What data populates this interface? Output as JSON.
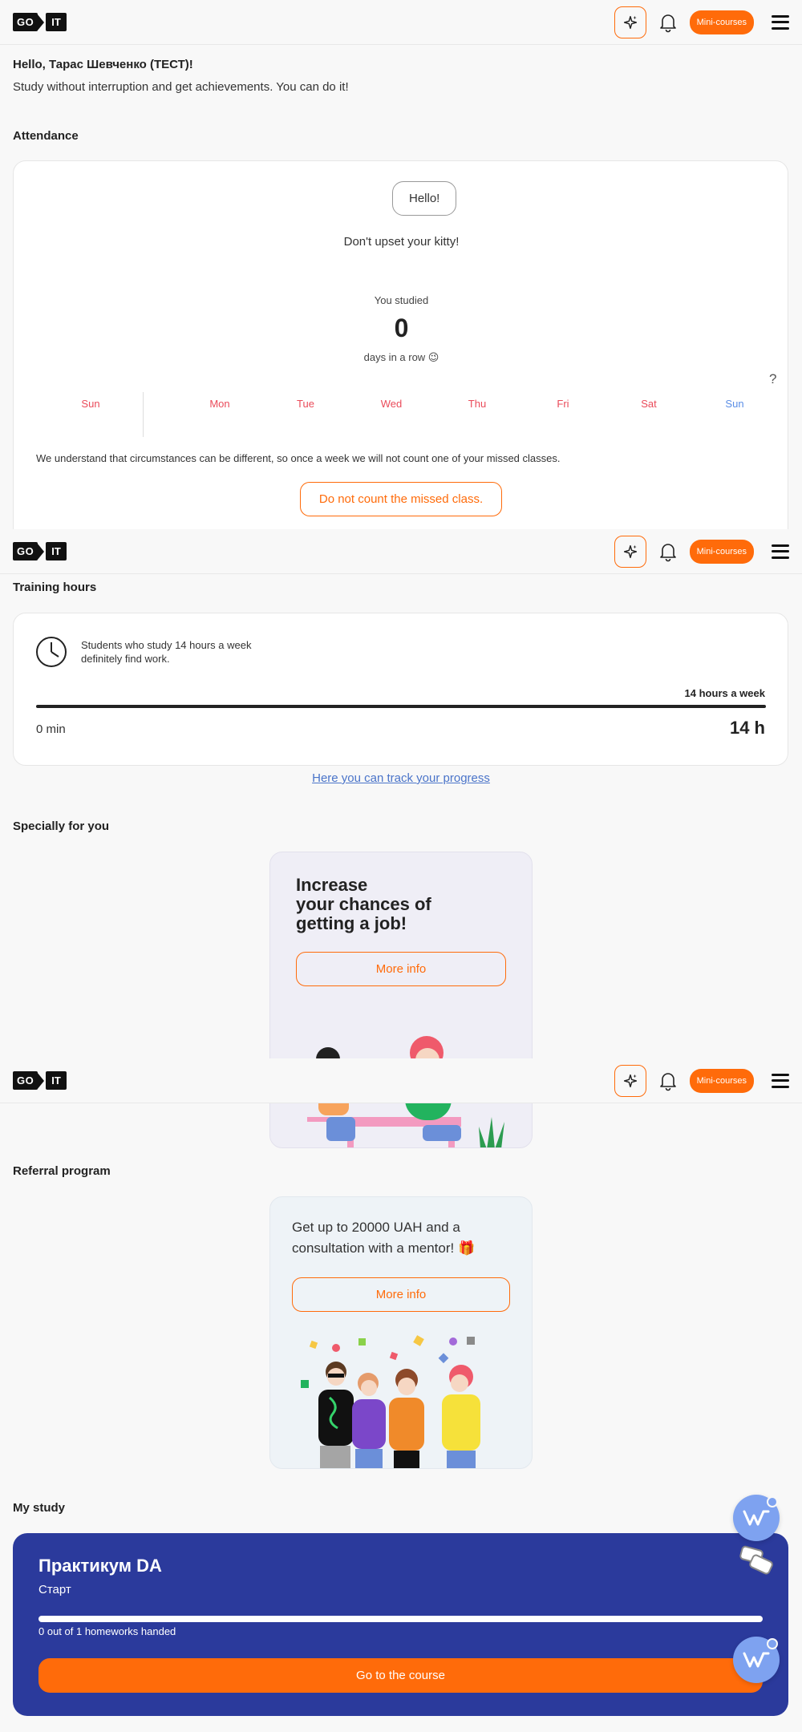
{
  "header": {
    "logo_go": "GO",
    "logo_it": "IT",
    "mini_courses": "Mini-courses"
  },
  "greeting": {
    "title": "Hello, Тарас Шевченко (ТЕСТ)!",
    "subtitle": "Study without interruption and get achievements. You can do it!"
  },
  "attendance": {
    "title": "Attendance",
    "bubble": "Hello!",
    "kitty": "Don't upset your kitty!",
    "you_studied": "You studied",
    "count": "0",
    "days_row": "days in a row 😉",
    "help": "?",
    "days": [
      "Sun",
      "Mon",
      "Tue",
      "Wed",
      "Thu",
      "Fri",
      "Sat",
      "Sun"
    ],
    "note": "We understand that circumstances can be different, so once a week we will not count one of your missed classes.",
    "button": "Do not count the missed class."
  },
  "training": {
    "title": "Training hours",
    "tip_line1": "Students who study 14 hours a week",
    "tip_line2": "definitely find work.",
    "goal": "14 hours a week",
    "current": "0 min",
    "target": "14 h",
    "progress": 0,
    "link": "Here you can track your progress"
  },
  "special": {
    "title": "Specially for you",
    "card_title_1": "Increase",
    "card_title_2": "your chances of",
    "card_title_3": "getting a job!",
    "button": "More info"
  },
  "referral": {
    "title": "Referral program",
    "text_1": "Get up to 20000 UAH and a",
    "text_2": "consultation with a mentor! 🎁",
    "button": "More info"
  },
  "my_study": {
    "title": "My study",
    "course_name": "Практикум DA",
    "course_stage": "Старт",
    "homework": "0 out of 1 homeworks handed",
    "button": "Go to the course"
  },
  "colors": {
    "accent": "#ff6b0a",
    "study_card": "#2b3a9c",
    "weekday_red": "#ea4b5a",
    "weekday_blue": "#5b8ee6"
  }
}
